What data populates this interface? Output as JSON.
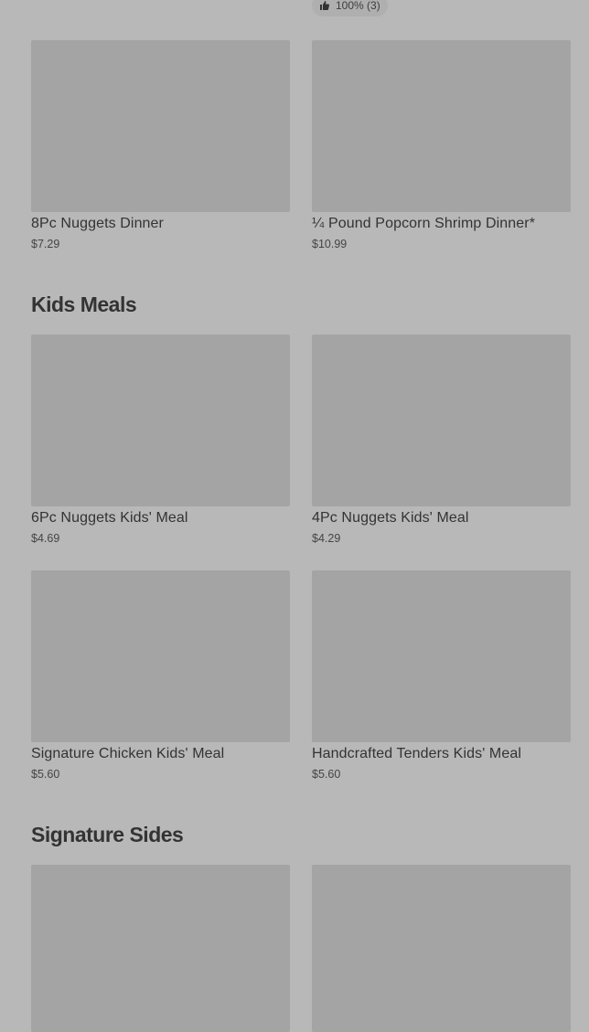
{
  "rating": {
    "icon": "thumbs-up-icon",
    "text": "100% (3)"
  },
  "top_items": [
    {
      "name": "8Pc Nuggets Dinner",
      "price": "$7.29"
    },
    {
      "name": "¼ Pound Popcorn Shrimp Dinner*",
      "price": "$10.99"
    }
  ],
  "sections": [
    {
      "title": "Kids Meals",
      "items": [
        {
          "name": "6Pc Nuggets Kids' Meal",
          "price": "$4.69"
        },
        {
          "name": "4Pc Nuggets Kids' Meal",
          "price": "$4.29"
        },
        {
          "name": "Signature Chicken Kids' Meal",
          "price": "$5.60"
        },
        {
          "name": "Handcrafted Tenders Kids' Meal",
          "price": "$5.60"
        }
      ]
    },
    {
      "title": "Signature Sides",
      "items": []
    }
  ],
  "colors": {
    "background": "#b8b8b8",
    "image_placeholder": "#a4a4a4",
    "text": "#333333"
  }
}
